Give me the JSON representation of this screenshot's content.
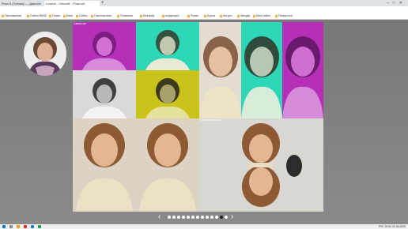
{
  "browser": {
    "tabs": [
      {
        "label": "Роза К (Голова) — Диалоги Блогов"
      },
      {
        "label": "Lowest - Cirkovle - Pinproof"
      }
    ],
    "new_tab_icon": "plus-icon",
    "address": "powerd.com/c/c/",
    "bookmarks": [
      "Приложения",
      "Сайты ВКАЕ",
      "Поиск",
      "Банк",
      "Сайты",
      "Партнерская",
      "Полезное",
      "Wordpay",
      "вордепрес",
      "Ролик",
      "Курсы",
      "Актуал",
      "Звезды",
      "Мои сайты",
      "Пятерочка"
    ]
  },
  "grid": {
    "cell_labels": [
      "Самостоя",
      "",
      "",
      "",
      "",
      "Самостоятельно"
    ]
  },
  "pager": {
    "prev_icon": "chevron-left-icon",
    "next_icon": "chevron-right-icon",
    "dot_count": 13,
    "active_index": 11
  },
  "taskbar": {
    "time": "20:04",
    "date": "21.06.2020",
    "lang": "РУС"
  },
  "colors": {
    "magenta": "#b52fb8",
    "cyan": "#2ed6b8",
    "yellow": "#c9c21b",
    "sepia": "#d8c9a8"
  }
}
